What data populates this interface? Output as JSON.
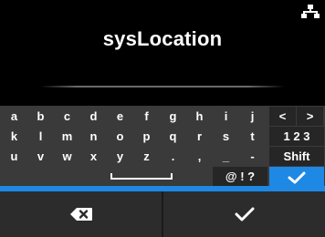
{
  "header": {
    "title": "sysLocation",
    "status_icon": "network-icon"
  },
  "input": {
    "value": ""
  },
  "keyboard": {
    "rows": [
      [
        "a",
        "b",
        "c",
        "d",
        "e",
        "f",
        "g",
        "h",
        "i",
        "j",
        "<",
        ">"
      ],
      [
        "k",
        "l",
        "m",
        "n",
        "o",
        "p",
        "q",
        "r",
        "s",
        "t",
        "123"
      ],
      [
        "u",
        "v",
        "w",
        "x",
        "y",
        "z",
        ".",
        ",",
        "_",
        "-",
        "Shift"
      ],
      [
        "space",
        "@!?",
        "enter"
      ]
    ],
    "labels": {
      "row1": [
        "a",
        "b",
        "c",
        "d",
        "e",
        "f",
        "g",
        "h",
        "i",
        "j",
        "<",
        ">"
      ],
      "row2": [
        "k",
        "l",
        "m",
        "n",
        "o",
        "p",
        "q",
        "r",
        "s",
        "t"
      ],
      "row3": [
        "u",
        "v",
        "w",
        "x",
        "y",
        "z",
        ".",
        ",",
        "_",
        "-"
      ],
      "mode_123": "1 2 3",
      "shift": "Shift",
      "symbols": "@ ! ?"
    },
    "icons": {
      "space": "space-bar-icon",
      "enter": "checkmark-icon"
    }
  },
  "footer": {
    "left_icon": "backspace-icon",
    "right_icon": "checkmark-icon"
  },
  "colors": {
    "accent": "#1e88e5",
    "keyboard_bg": "#3a3a3a",
    "footer_bg": "#2c2c2c"
  }
}
